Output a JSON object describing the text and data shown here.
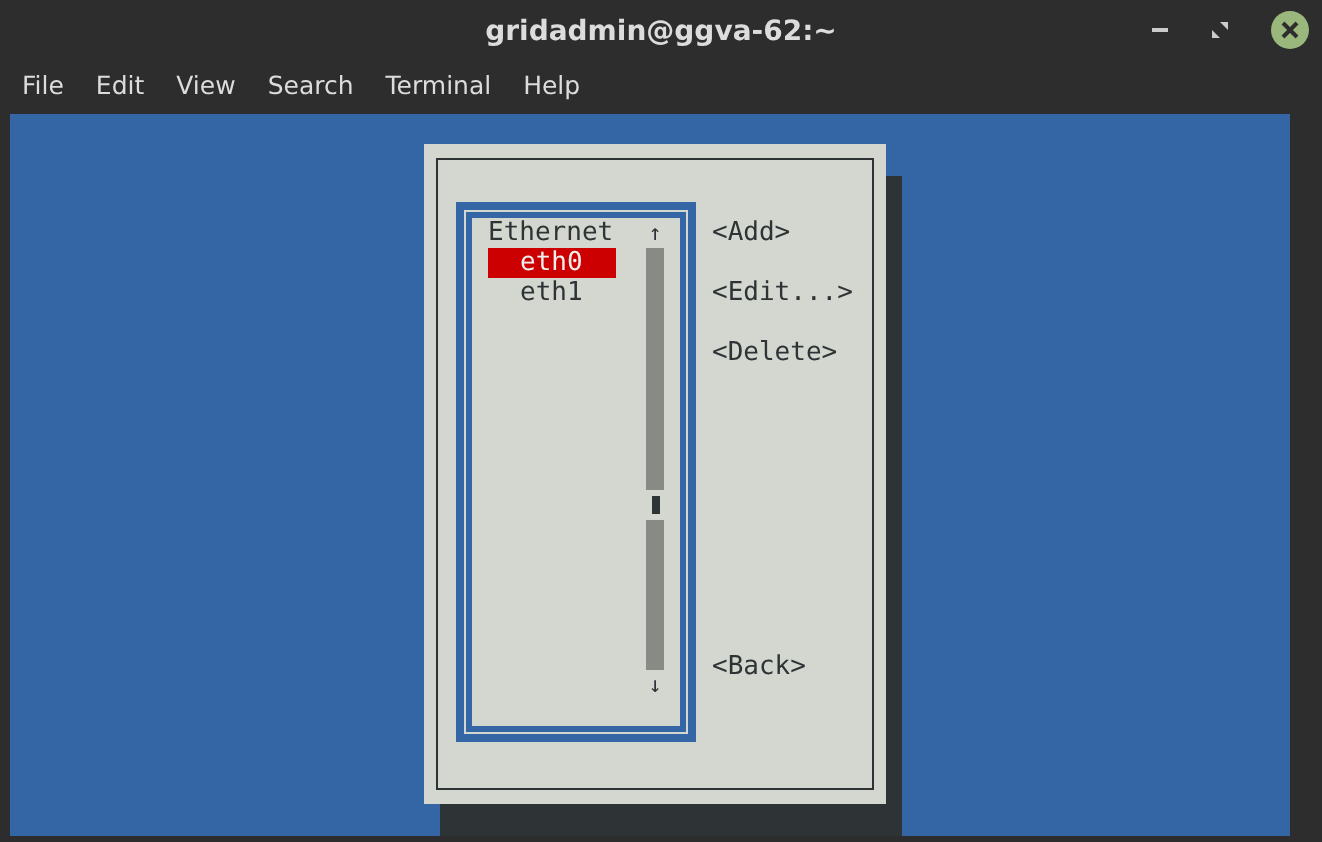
{
  "window": {
    "title": "gridadmin@ggva-62:~"
  },
  "menu": [
    "File",
    "Edit",
    "View",
    "Search",
    "Terminal",
    "Help"
  ],
  "dialog": {
    "list": {
      "header": "Ethernet",
      "items": [
        {
          "label": "eth0",
          "selected": true
        },
        {
          "label": "eth1",
          "selected": false
        }
      ],
      "scroll_up": "↑",
      "scroll_down": "↓"
    },
    "buttons": [
      {
        "label": "<Add>",
        "kind": "top"
      },
      {
        "label": "<Edit...>",
        "kind": "top"
      },
      {
        "label": "<Delete>",
        "kind": "top"
      },
      {
        "label": "<Back>",
        "kind": "bottom"
      }
    ]
  }
}
